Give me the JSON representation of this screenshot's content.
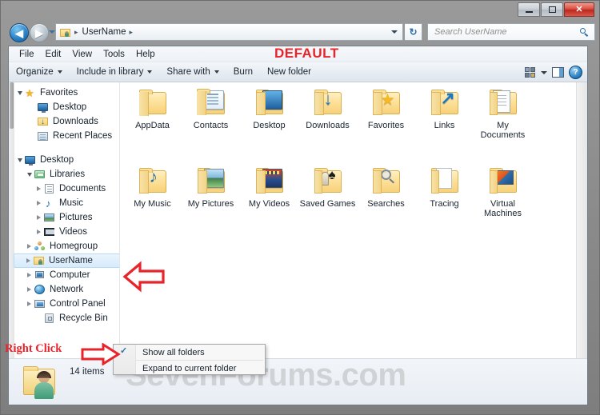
{
  "window": {
    "title": "",
    "buttons": {
      "minimize": "minimize",
      "maximize": "maximize",
      "close": "✕"
    }
  },
  "address": {
    "back_glyph": "◀",
    "forward_glyph": "▶",
    "crumbs": [
      "UserName"
    ],
    "separator": "▸",
    "refresh_glyph": "↻"
  },
  "search": {
    "placeholder": "Search UserName",
    "icon": "search-icon"
  },
  "menubar": {
    "items": [
      "File",
      "Edit",
      "View",
      "Tools",
      "Help"
    ]
  },
  "annotations": {
    "default_tag": "DEFAULT",
    "right_click_label": "Right Click",
    "accent_red": "#e8232a"
  },
  "commandbar": {
    "items": [
      {
        "label": "Organize",
        "has_dropdown": true
      },
      {
        "label": "Include in library",
        "has_dropdown": true
      },
      {
        "label": "Share with",
        "has_dropdown": true
      },
      {
        "label": "Burn",
        "has_dropdown": false
      },
      {
        "label": "New folder",
        "has_dropdown": false
      }
    ],
    "right_icons": [
      "view-layout-icon",
      "chevron-down-icon",
      "preview-pane-icon",
      "help-icon"
    ],
    "help_glyph": "?"
  },
  "navpane": {
    "groups": [
      {
        "items": [
          {
            "label": "Favorites",
            "icon": "star-icon",
            "expander": "open",
            "indent": 0,
            "selected": false
          },
          {
            "label": "Desktop",
            "icon": "monitor-icon",
            "expander": "none",
            "indent": 1,
            "selected": false
          },
          {
            "label": "Downloads",
            "icon": "downloads-folder-icon",
            "expander": "none",
            "indent": 1,
            "selected": false
          },
          {
            "label": "Recent Places",
            "icon": "recent-places-icon",
            "expander": "none",
            "indent": 1,
            "selected": false
          }
        ]
      },
      {
        "items": [
          {
            "label": "Desktop",
            "icon": "monitor-icon",
            "expander": "open",
            "indent": 0,
            "selected": false
          },
          {
            "label": "Libraries",
            "icon": "libraries-icon",
            "expander": "open",
            "indent": 1,
            "selected": false
          },
          {
            "label": "Documents",
            "icon": "documents-icon",
            "expander": "closed",
            "indent": 2,
            "selected": false
          },
          {
            "label": "Music",
            "icon": "music-icon",
            "expander": "closed",
            "indent": 2,
            "selected": false
          },
          {
            "label": "Pictures",
            "icon": "pictures-icon",
            "expander": "closed",
            "indent": 2,
            "selected": false
          },
          {
            "label": "Videos",
            "icon": "videos-icon",
            "expander": "closed",
            "indent": 2,
            "selected": false
          },
          {
            "label": "Homegroup",
            "icon": "homegroup-icon",
            "expander": "closed",
            "indent": 1,
            "selected": false
          },
          {
            "label": "UserName",
            "icon": "user-folder-icon",
            "expander": "closed",
            "indent": 1,
            "selected": true
          },
          {
            "label": "Computer",
            "icon": "computer-icon",
            "expander": "closed",
            "indent": 1,
            "selected": false
          },
          {
            "label": "Network",
            "icon": "network-icon",
            "expander": "closed",
            "indent": 1,
            "selected": false
          },
          {
            "label": "Control Panel",
            "icon": "control-panel-icon",
            "expander": "closed",
            "indent": 1,
            "selected": false
          },
          {
            "label": "Recycle Bin",
            "icon": "recycle-bin-icon",
            "expander": "none",
            "indent": 1,
            "selected": false
          }
        ]
      }
    ]
  },
  "content": {
    "items": [
      {
        "label": "AppData",
        "icon": "folder-plain-icon"
      },
      {
        "label": "Contacts",
        "icon": "folder-contacts-icon"
      },
      {
        "label": "Desktop",
        "icon": "folder-desktop-icon"
      },
      {
        "label": "Downloads",
        "icon": "folder-downloads-icon"
      },
      {
        "label": "Favorites",
        "icon": "folder-favorites-icon"
      },
      {
        "label": "Links",
        "icon": "folder-links-icon"
      },
      {
        "label": "My Documents",
        "icon": "folder-documents-icon"
      },
      {
        "label": "My Music",
        "icon": "folder-music-icon"
      },
      {
        "label": "My Pictures",
        "icon": "folder-pictures-icon"
      },
      {
        "label": "My Videos",
        "icon": "folder-videos-icon"
      },
      {
        "label": "Saved Games",
        "icon": "folder-saved-games-icon"
      },
      {
        "label": "Searches",
        "icon": "folder-searches-icon"
      },
      {
        "label": "Tracing",
        "icon": "folder-tracing-icon"
      },
      {
        "label": "Virtual Machines",
        "icon": "folder-virtual-machines-icon"
      }
    ]
  },
  "statusbar": {
    "item_count": "14 items",
    "icon": "user-folder-large-icon",
    "watermark": "SevenForums.com"
  },
  "contextmenu": {
    "items": [
      {
        "label": "Show all folders",
        "checked": true
      },
      {
        "label": "Expand to current folder",
        "checked": false
      }
    ],
    "check_glyph": "✓"
  }
}
